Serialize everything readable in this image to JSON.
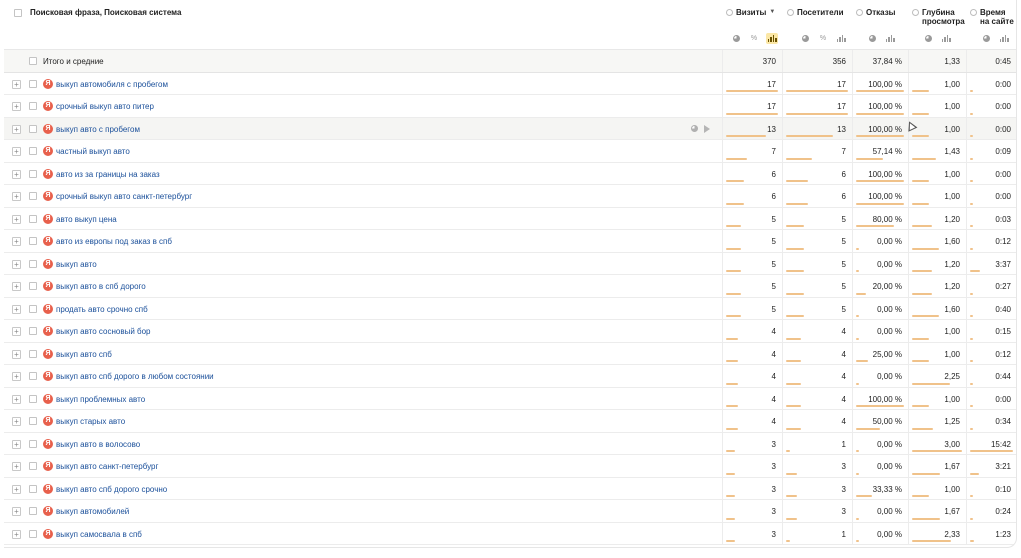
{
  "header": {
    "dimension_title": "Поисковая фраза, Поисковая система",
    "metrics": [
      {
        "key": "visits",
        "label": "Визиты",
        "sorted": true
      },
      {
        "key": "visitors",
        "label": "Посетители",
        "sorted": false
      },
      {
        "key": "bounce",
        "label": "Отказы",
        "sorted": false
      },
      {
        "key": "depth",
        "label": "Глубина\nпросмотра",
        "sorted": false
      },
      {
        "key": "time",
        "label": "Время\nна сайте",
        "sorted": false
      }
    ],
    "sort_caret": "▼",
    "percent_symbol": "%"
  },
  "totals": {
    "label": "Итого и средние",
    "visits": "370",
    "visitors": "356",
    "bounce": "37,84 %",
    "depth": "1,33",
    "time": "0:45"
  },
  "engine_badge": "Я",
  "expand_symbol": "+",
  "rows": [
    {
      "phrase": "выкуп автомобиля с пробегом",
      "visits": "17",
      "visitors": "17",
      "bounce": "100,00 %",
      "depth": "1,00",
      "time": "0:00"
    },
    {
      "phrase": "срочный выкуп авто питер",
      "visits": "17",
      "visitors": "17",
      "bounce": "100,00 %",
      "depth": "1,00",
      "time": "0:00"
    },
    {
      "phrase": "выкуп авто с пробегом",
      "visits": "13",
      "visitors": "13",
      "bounce": "100,00 %",
      "depth": "1,00",
      "time": "0:00"
    },
    {
      "phrase": "частный выкуп авто",
      "visits": "7",
      "visitors": "7",
      "bounce": "57,14 %",
      "depth": "1,43",
      "time": "0:09"
    },
    {
      "phrase": "авто из за границы на заказ",
      "visits": "6",
      "visitors": "6",
      "bounce": "100,00 %",
      "depth": "1,00",
      "time": "0:00"
    },
    {
      "phrase": "срочный выкуп авто санкт-петербург",
      "visits": "6",
      "visitors": "6",
      "bounce": "100,00 %",
      "depth": "1,00",
      "time": "0:00"
    },
    {
      "phrase": "авто выкуп цена",
      "visits": "5",
      "visitors": "5",
      "bounce": "80,00 %",
      "depth": "1,20",
      "time": "0:03"
    },
    {
      "phrase": "авто из европы под заказ в спб",
      "visits": "5",
      "visitors": "5",
      "bounce": "0,00 %",
      "depth": "1,60",
      "time": "0:12"
    },
    {
      "phrase": "выкуп авто",
      "visits": "5",
      "visitors": "5",
      "bounce": "0,00 %",
      "depth": "1,20",
      "time": "3:37"
    },
    {
      "phrase": "выкуп авто в спб дорого",
      "visits": "5",
      "visitors": "5",
      "bounce": "20,00 %",
      "depth": "1,20",
      "time": "0:27"
    },
    {
      "phrase": "продать авто срочно спб",
      "visits": "5",
      "visitors": "5",
      "bounce": "0,00 %",
      "depth": "1,60",
      "time": "0:40"
    },
    {
      "phrase": "выкуп авто сосновый бор",
      "visits": "4",
      "visitors": "4",
      "bounce": "0,00 %",
      "depth": "1,00",
      "time": "0:15"
    },
    {
      "phrase": "выкуп авто спб",
      "visits": "4",
      "visitors": "4",
      "bounce": "25,00 %",
      "depth": "1,00",
      "time": "0:12"
    },
    {
      "phrase": "выкуп авто спб дорого в любом состоянии",
      "visits": "4",
      "visitors": "4",
      "bounce": "0,00 %",
      "depth": "2,25",
      "time": "0:44"
    },
    {
      "phrase": "выкуп проблемных авто",
      "visits": "4",
      "visitors": "4",
      "bounce": "100,00 %",
      "depth": "1,00",
      "time": "0:00"
    },
    {
      "phrase": "выкуп старых авто",
      "visits": "4",
      "visitors": "4",
      "bounce": "50,00 %",
      "depth": "1,25",
      "time": "0:34"
    },
    {
      "phrase": "выкуп авто в волосово",
      "visits": "3",
      "visitors": "1",
      "bounce": "0,00 %",
      "depth": "3,00",
      "time": "15:42"
    },
    {
      "phrase": "выкуп авто санкт-петербург",
      "visits": "3",
      "visitors": "3",
      "bounce": "0,00 %",
      "depth": "1,67",
      "time": "3:21"
    },
    {
      "phrase": "выкуп авто спб дорого срочно",
      "visits": "3",
      "visitors": "3",
      "bounce": "33,33 %",
      "depth": "1,00",
      "time": "0:10"
    },
    {
      "phrase": "выкуп автомобилей",
      "visits": "3",
      "visitors": "3",
      "bounce": "0,00 %",
      "depth": "1,67",
      "time": "0:24"
    },
    {
      "phrase": "выкуп самосвала в спб",
      "visits": "3",
      "visitors": "1",
      "bounce": "0,00 %",
      "depth": "2,33",
      "time": "1:23"
    }
  ],
  "hovered_row": 2,
  "colors": {
    "link": "#1a4f9a",
    "engine_badge": "#e8604c",
    "bar": "#f0c28a",
    "active_tool": "#fbe7a6"
  }
}
